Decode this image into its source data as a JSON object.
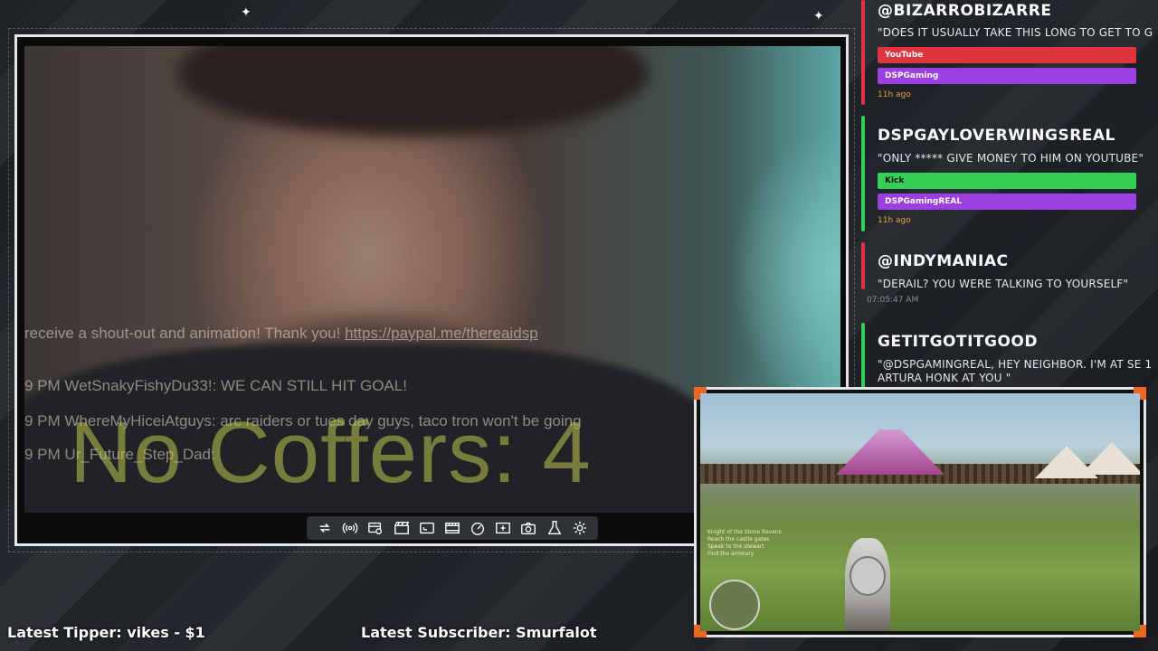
{
  "webcam": {
    "overlay_line1": "receive a shout-out and animation! Thank you!",
    "overlay_link": "https://paypal.me/thereaidsp",
    "overlay_line2_time": "9 PM",
    "overlay_line2": "WetSnakyFishyDu33!: WE CAN STILL HIT GOAL!",
    "overlay_line3_time": "9 PM",
    "overlay_line3": "WhereMyHiceiAtguys: arc raiders or tues day guys, taco tron won't be going",
    "overlay_line4_time": "9 PM",
    "overlay_line4": "Ur_Future_Step_Dad:",
    "overlay_big": "No Coffers: 4"
  },
  "toolbar": {
    "icons": [
      "repeat-icon",
      "broadcast-icon",
      "preview-icon",
      "clapper-icon",
      "crop-icon",
      "film-icon",
      "speedometer-icon",
      "add-scene-icon",
      "camera-icon",
      "flask-icon",
      "gear-icon"
    ]
  },
  "chat": {
    "messages": [
      {
        "name": "@BIZARROBIZARRE",
        "text": "\"DOES IT USUALLY TAKE THIS LONG TO GET TO G",
        "platform": "YouTube",
        "platform_color": "#e0353f",
        "channel": "DSPGaming",
        "channel_color": "#9b3fe0",
        "ago": "11h ago",
        "bar_color": "#e0353f"
      },
      {
        "name": "DSPGAYLOVERWINGSREAL",
        "text": "\"ONLY ***** GIVE MONEY TO HIM ON YOUTUBE\"",
        "platform": "Kick",
        "platform_color": "#34d058",
        "channel": "DSPGamingREAL",
        "channel_color": "#9b3fe0",
        "ago": "11h ago",
        "bar_color": "#34d058"
      },
      {
        "name": "@INDYMANIAC",
        "text": "\"DERAIL? YOU WERE TALKING TO YOURSELF\"",
        "time": "07:05:47 AM",
        "bar_color": "#e0353f"
      },
      {
        "name": "GETITGOTITGOOD",
        "text": "\"@DSPGAMINGREAL, HEY NEIGHBOR. I'M AT SE 1",
        "text2": "ARTURA HONK AT YOU \"",
        "bar_color": "#34d058"
      }
    ]
  },
  "game": {
    "quest_lines": [
      "Knight of the Stone Ravens",
      "Reach the castle gates",
      "Speak to the stewart",
      "Find the armoury"
    ]
  },
  "footer": {
    "tipper": "Latest Tipper: vikes - $1",
    "subscriber": "Latest Subscriber: Smurfalot"
  },
  "colors": {
    "accent_orange": "#f0651f",
    "frame_white": "#e6e6e6",
    "background": "#1e2328"
  }
}
